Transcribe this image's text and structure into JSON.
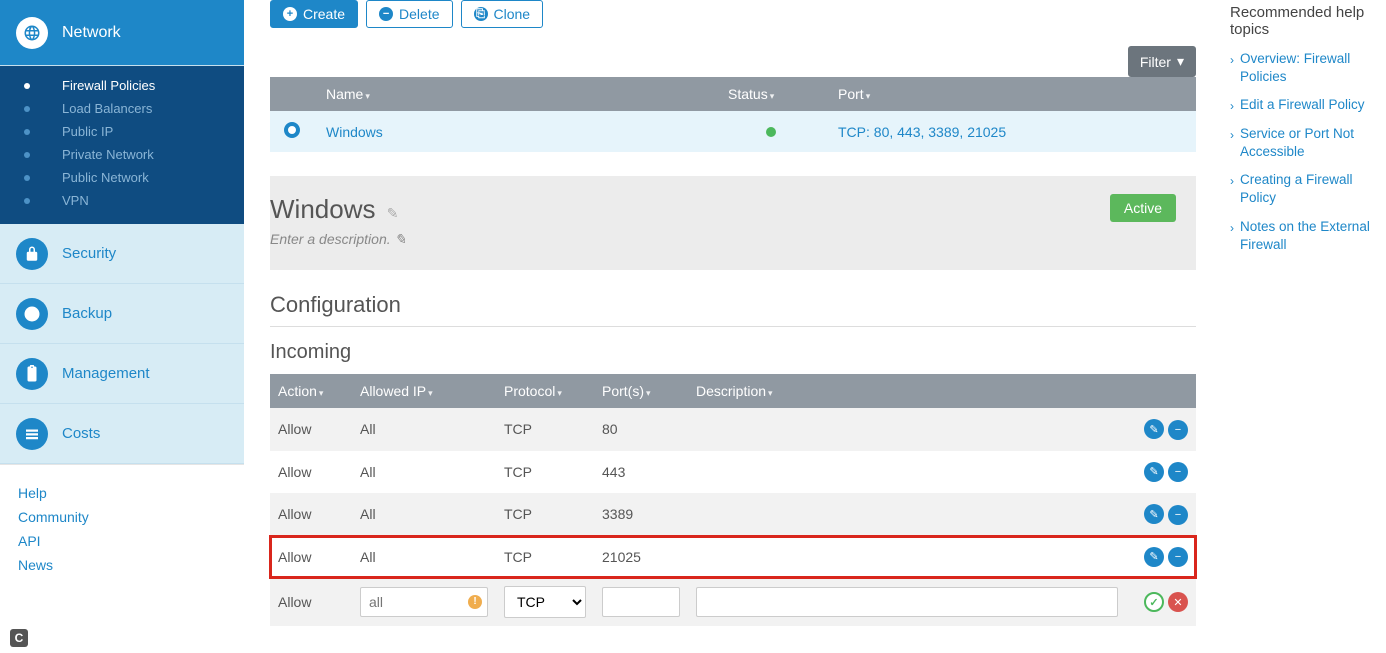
{
  "sidebar": {
    "items": [
      {
        "label": "Network",
        "iconName": "globe-icon",
        "active": true
      },
      {
        "label": "Security",
        "iconName": "lock-icon"
      },
      {
        "label": "Backup",
        "iconName": "clock-icon"
      },
      {
        "label": "Management",
        "iconName": "clipboard-icon"
      },
      {
        "label": "Costs",
        "iconName": "money-icon"
      }
    ],
    "subnav": [
      {
        "label": "Firewall Policies",
        "active": true
      },
      {
        "label": "Load Balancers"
      },
      {
        "label": "Public IP"
      },
      {
        "label": "Private Network"
      },
      {
        "label": "Public Network"
      },
      {
        "label": "VPN"
      }
    ],
    "footerLinks": [
      "Help",
      "Community",
      "API",
      "News"
    ]
  },
  "actions": {
    "create": "Create",
    "delete": "Delete",
    "clone": "Clone",
    "filter": "Filter"
  },
  "policiesTable": {
    "headers": {
      "name": "Name",
      "status": "Status",
      "port": "Port"
    },
    "rows": [
      {
        "name": "Windows",
        "status": "active",
        "port": "TCP: 80, 443, 3389, 21025",
        "selected": true
      }
    ]
  },
  "detail": {
    "title": "Windows",
    "descriptionPlaceholder": "Enter a description.",
    "statusBadge": "Active"
  },
  "config": {
    "title": "Configuration",
    "incomingTitle": "Incoming",
    "headers": {
      "action": "Action",
      "allowedIp": "Allowed IP",
      "protocol": "Protocol",
      "ports": "Port(s)",
      "description": "Description"
    },
    "rules": [
      {
        "action": "Allow",
        "ip": "All",
        "protocol": "TCP",
        "ports": "80",
        "description": "",
        "highlight": false
      },
      {
        "action": "Allow",
        "ip": "All",
        "protocol": "TCP",
        "ports": "443",
        "description": "",
        "highlight": false
      },
      {
        "action": "Allow",
        "ip": "All",
        "protocol": "TCP",
        "ports": "3389",
        "description": "",
        "highlight": false
      },
      {
        "action": "Allow",
        "ip": "All",
        "protocol": "TCP",
        "ports": "21025",
        "description": "",
        "highlight": true
      }
    ],
    "formRow": {
      "action": "Allow",
      "ipPlaceholder": "all",
      "protocol": "TCP",
      "portsValue": "",
      "descValue": ""
    }
  },
  "help": {
    "title": "Recommended help topics",
    "links": [
      "Overview: Firewall Policies",
      "Edit a Firewall Policy",
      "Service or Port Not Accessible",
      "Creating a Firewall Policy",
      "Notes on the External Firewall"
    ]
  }
}
